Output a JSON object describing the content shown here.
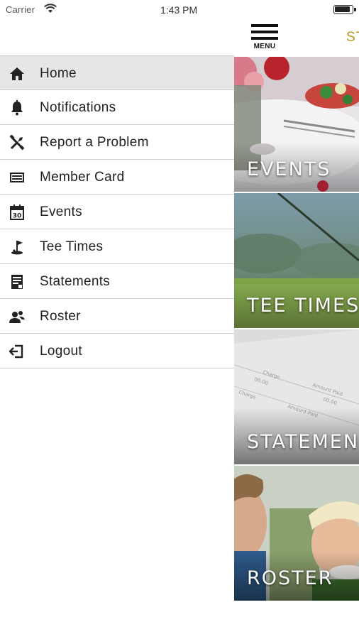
{
  "status_bar": {
    "carrier": "Carrier",
    "time": "1:43 PM"
  },
  "drawer": {
    "items": [
      {
        "label": "Home",
        "icon": "home-icon",
        "active": true
      },
      {
        "label": "Notifications",
        "icon": "bell-icon"
      },
      {
        "label": "Report a Problem",
        "icon": "tools-icon"
      },
      {
        "label": "Member Card",
        "icon": "card-icon"
      },
      {
        "label": "Events",
        "icon": "calendar-icon"
      },
      {
        "label": "Tee Times",
        "icon": "golf-flag-icon"
      },
      {
        "label": "Statements",
        "icon": "statement-icon"
      },
      {
        "label": "Roster",
        "icon": "people-icon"
      },
      {
        "label": "Logout",
        "icon": "logout-icon"
      }
    ]
  },
  "main": {
    "menu_button_label": "MENU",
    "header_title": "ST",
    "tiles": [
      {
        "label": "EVENTS"
      },
      {
        "label": "TEE TIMES"
      },
      {
        "label": "STATEMEN"
      },
      {
        "label": "ROSTER"
      }
    ]
  },
  "colors": {
    "accent_gold": "#b8961b",
    "active_row": "#e6e6e6",
    "divider": "#cfcfcf"
  }
}
